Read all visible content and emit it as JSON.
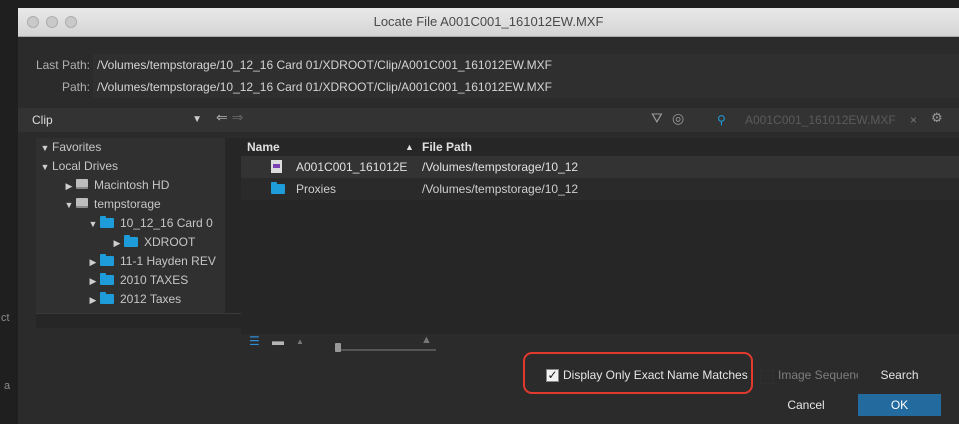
{
  "window": {
    "title": "Locate File A001C001_161012EW.MXF"
  },
  "paths": {
    "last_path_label": "Last Path:",
    "last_path_value": "/Volumes/tempstorage/10_12_16 Card 01/XDROOT/Clip/A001C001_161012EW.MXF",
    "path_label": "Path:",
    "path_value": "/Volumes/tempstorage/10_12_16 Card 01/XDROOT/Clip/A001C001_161012EW.MXF"
  },
  "toolbar": {
    "location_dropdown": "Clip",
    "search_value": "A001C001_161012EW.MXF"
  },
  "tree": {
    "favorites": "Favorites",
    "local_drives": "Local Drives",
    "items": [
      {
        "label": "Macintosh HD",
        "type": "drive",
        "expanded": false
      },
      {
        "label": "tempstorage",
        "type": "drive",
        "expanded": true
      },
      {
        "label": "10_12_16 Card 0",
        "type": "folder",
        "expanded": true
      },
      {
        "label": "XDROOT",
        "type": "folder",
        "expanded": false
      },
      {
        "label": "11-1 Hayden REV",
        "type": "folder",
        "expanded": false
      },
      {
        "label": "2010 TAXES",
        "type": "folder",
        "expanded": false
      },
      {
        "label": "2012 Taxes",
        "type": "folder",
        "expanded": false
      }
    ]
  },
  "files": {
    "columns": [
      "Name",
      "File Path"
    ],
    "rows": [
      {
        "name": "A001C001_161012E",
        "path": "/Volumes/tempstorage/10_12",
        "icon": "mxf-file-icon"
      },
      {
        "name": "Proxies",
        "path": "/Volumes/tempstorage/10_12",
        "icon": "folder-icon"
      }
    ]
  },
  "options": {
    "exact_match_label": "Display Only Exact Name Matches",
    "exact_match_checked": true,
    "image_sequence_label": "Image Sequence"
  },
  "buttons": {
    "search": "Search",
    "cancel": "Cancel",
    "ok": "OK"
  },
  "colors": {
    "accent_blue": "#1e9bd9",
    "ok_button": "#236a9f",
    "highlight_outline": "#e03a2f"
  }
}
